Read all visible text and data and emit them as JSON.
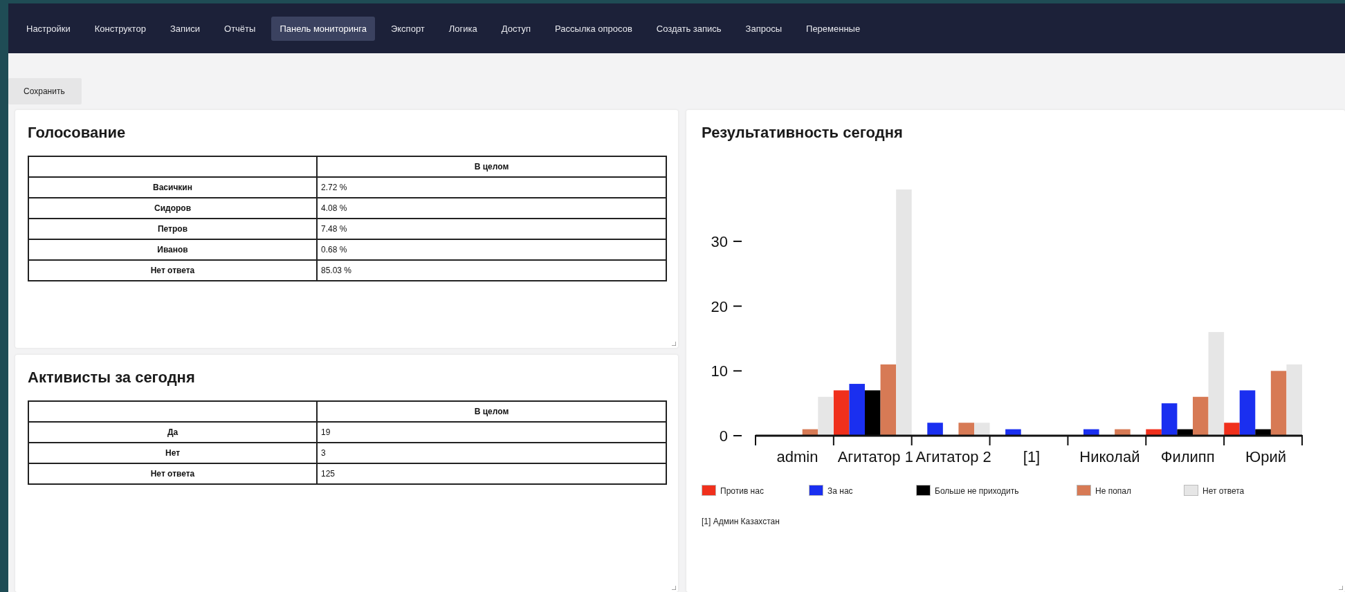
{
  "nav": {
    "items": [
      {
        "label": "Настройки",
        "selected": false
      },
      {
        "label": "Конструктор",
        "selected": false
      },
      {
        "label": "Записи",
        "selected": false
      },
      {
        "label": "Отчёты",
        "selected": false
      },
      {
        "label": "Панель мониторинга",
        "selected": true
      },
      {
        "label": "Экспорт",
        "selected": false
      },
      {
        "label": "Логика",
        "selected": false
      },
      {
        "label": "Доступ",
        "selected": false
      },
      {
        "label": "Рассылка опросов",
        "selected": false
      },
      {
        "label": "Создать запись",
        "selected": false
      },
      {
        "label": "Запросы",
        "selected": false
      },
      {
        "label": "Переменные",
        "selected": false
      }
    ]
  },
  "save_button": "Сохранить",
  "tables": [
    {
      "title": "Голосование",
      "column": "В целом",
      "rows": [
        {
          "label": "Васичкин",
          "value": "2.72 %"
        },
        {
          "label": "Сидоров",
          "value": "4.08 %"
        },
        {
          "label": "Петров",
          "value": "7.48 %"
        },
        {
          "label": "Иванов",
          "value": "0.68 %"
        },
        {
          "label": "Нет ответа",
          "value": "85.03 %"
        }
      ]
    },
    {
      "title": "Активисты за сегодня",
      "column": "В целом",
      "rows": [
        {
          "label": "Да",
          "value": "19"
        },
        {
          "label": "Нет",
          "value": "3"
        },
        {
          "label": "Нет ответа",
          "value": "125"
        }
      ]
    }
  ],
  "results": {
    "title": "Результативность сегодня",
    "chart_data": {
      "type": "bar",
      "categories": [
        "admin",
        "Агитатор 1",
        "Агитатор 2",
        "[1]",
        "Николай",
        "Филипп",
        "Юрий"
      ],
      "series": [
        {
          "name": "Против нас",
          "color": "#f0301c",
          "values": [
            0,
            7,
            0,
            0,
            0,
            1,
            2
          ]
        },
        {
          "name": "За нас",
          "color": "#1a2ff0",
          "values": [
            0,
            8,
            2,
            1,
            1,
            5,
            7
          ]
        },
        {
          "name": "Больше не приходить",
          "color": "#000000",
          "values": [
            0,
            7,
            0,
            0,
            0,
            1,
            1
          ]
        },
        {
          "name": "Не попал",
          "color": "#d77a55",
          "values": [
            1,
            11,
            2,
            0,
            1,
            6,
            10
          ]
        },
        {
          "name": "Нет ответа",
          "color": "#e6e6e6",
          "values": [
            6,
            38,
            2,
            0,
            0,
            16,
            11
          ]
        }
      ],
      "ylim": [
        0,
        38
      ],
      "yticks": [
        0,
        10,
        20,
        30
      ]
    },
    "footnote": "[1] Админ Казахстан"
  }
}
